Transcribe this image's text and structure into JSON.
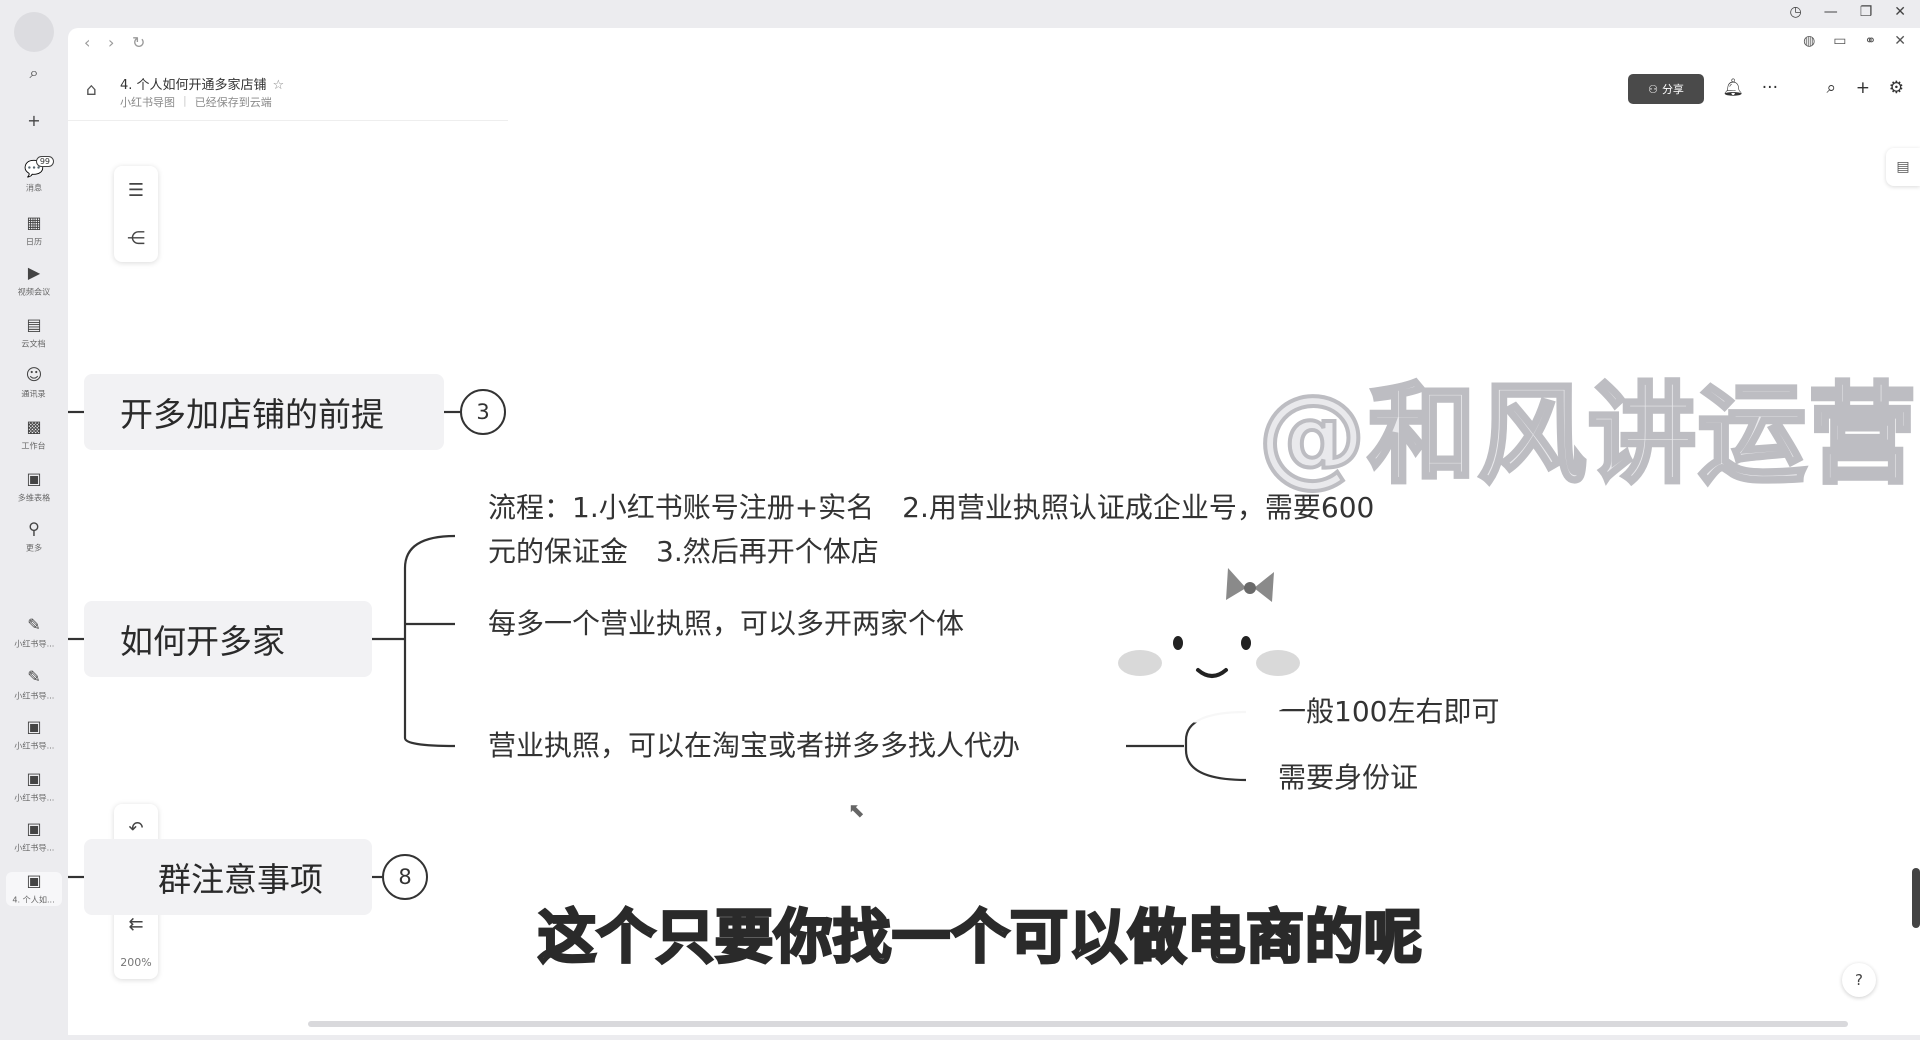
{
  "rail": {
    "items": [
      {
        "icon": "search-icon",
        "glyph": "⌕",
        "label": ""
      },
      {
        "icon": "plus-icon",
        "glyph": "+",
        "label": ""
      },
      {
        "icon": "message-icon",
        "glyph": "💬",
        "label": "消息",
        "badge": "99"
      },
      {
        "icon": "calendar-icon",
        "glyph": "▦",
        "label": "日历"
      },
      {
        "icon": "video-icon",
        "glyph": "▶",
        "label": "视频会议"
      },
      {
        "icon": "doc-icon",
        "glyph": "▤",
        "label": "云文档"
      },
      {
        "icon": "contacts-icon",
        "glyph": "☺",
        "label": "通讯录"
      },
      {
        "icon": "workbench-icon",
        "glyph": "▩",
        "label": "工作台"
      },
      {
        "icon": "apps-icon",
        "glyph": "▣",
        "label": "多维表格"
      },
      {
        "icon": "more-icon",
        "glyph": "⚲",
        "label": "更多"
      },
      {
        "icon": "recent-doc-icon",
        "glyph": "✎",
        "label": "小红书导..."
      },
      {
        "icon": "recent-doc-icon",
        "glyph": "✎",
        "label": "小红书导..."
      },
      {
        "icon": "recent-doc-icon",
        "glyph": "▣",
        "label": "小红书导..."
      },
      {
        "icon": "recent-doc-icon",
        "glyph": "▣",
        "label": "小红书导..."
      },
      {
        "icon": "recent-doc-icon",
        "glyph": "▣",
        "label": "小红书导..."
      },
      {
        "icon": "recent-doc-icon",
        "glyph": "▣",
        "label": "4. 个人如..."
      }
    ]
  },
  "doc": {
    "title": "4. 个人如何开通多家店铺",
    "breadcrumb": "小红书导图",
    "save_status": "已经保存到云端",
    "share_label": "分享"
  },
  "mindmap": {
    "node1": {
      "label": "开多加店铺的前提",
      "count": "3"
    },
    "node2": {
      "label": "如何开多家"
    },
    "node3": {
      "label": "群注意事项",
      "count": "8"
    },
    "leaf_process_1": "流程：1.小红书账号注册+实名　2.用营业执照认证成企业号，需要600",
    "leaf_process_2": "元的保证金　3.然后再开个体店",
    "leaf_each": "每多一个营业执照，可以多开两家个体",
    "leaf_license": "营业执照，可以在淘宝或者拼多多找人代办",
    "leaf_price": "一般100左右即可",
    "leaf_id": "需要身份证"
  },
  "zoom": "200%",
  "watermark": "@和风讲运营",
  "subtitle": "这个只要你找一个可以做电商的呢"
}
